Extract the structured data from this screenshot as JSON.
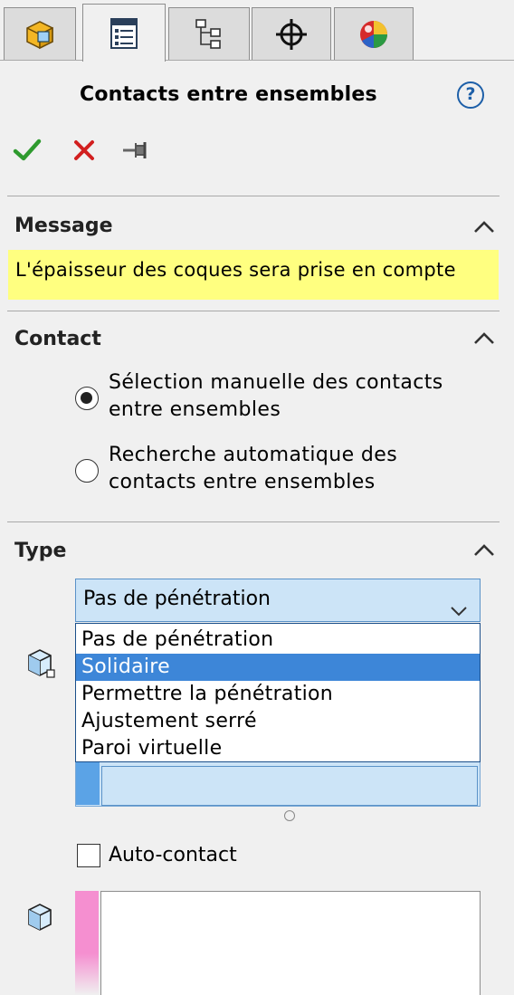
{
  "tabs": [
    {
      "icon": "feature-manager-icon",
      "active": false
    },
    {
      "icon": "property-manager-icon",
      "active": true
    },
    {
      "icon": "configuration-manager-icon",
      "active": false
    },
    {
      "icon": "dimxpert-icon",
      "active": false
    },
    {
      "icon": "display-manager-icon",
      "active": false
    }
  ],
  "header": {
    "title": "Contacts entre ensembles",
    "help_label": "?"
  },
  "actions": {
    "ok_icon": "check-icon",
    "cancel_icon": "close-icon",
    "pin_icon": "pushpin-icon",
    "ok_color": "#2e9a2e",
    "cancel_color": "#d21f1f"
  },
  "message_section": {
    "title": "Message",
    "text": "L'épaisseur des coques sera prise en compte",
    "highlight_color": "#ffff80"
  },
  "contact_section": {
    "title": "Contact",
    "options": [
      {
        "line1": "Sélection manuelle des contacts",
        "line2": "entre ensembles",
        "selected": true
      },
      {
        "line1": "Recherche automatique des",
        "line2": "contacts entre ensembles",
        "selected": false
      }
    ]
  },
  "type_section": {
    "title": "Type",
    "selected_value": "Pas de pénétration",
    "dropdown_options": [
      "Pas de pénétration",
      "Solidaire",
      "Permettre la pénétration",
      "Ajustement serré",
      "Paroi virtuelle"
    ],
    "highlighted_index": 1,
    "self_contact_label": "Auto-contact",
    "self_contact_checked": false,
    "set1_color": "#5ba3e6",
    "set2_color": "#f58fd0",
    "selection_color": "#cce4f7"
  }
}
